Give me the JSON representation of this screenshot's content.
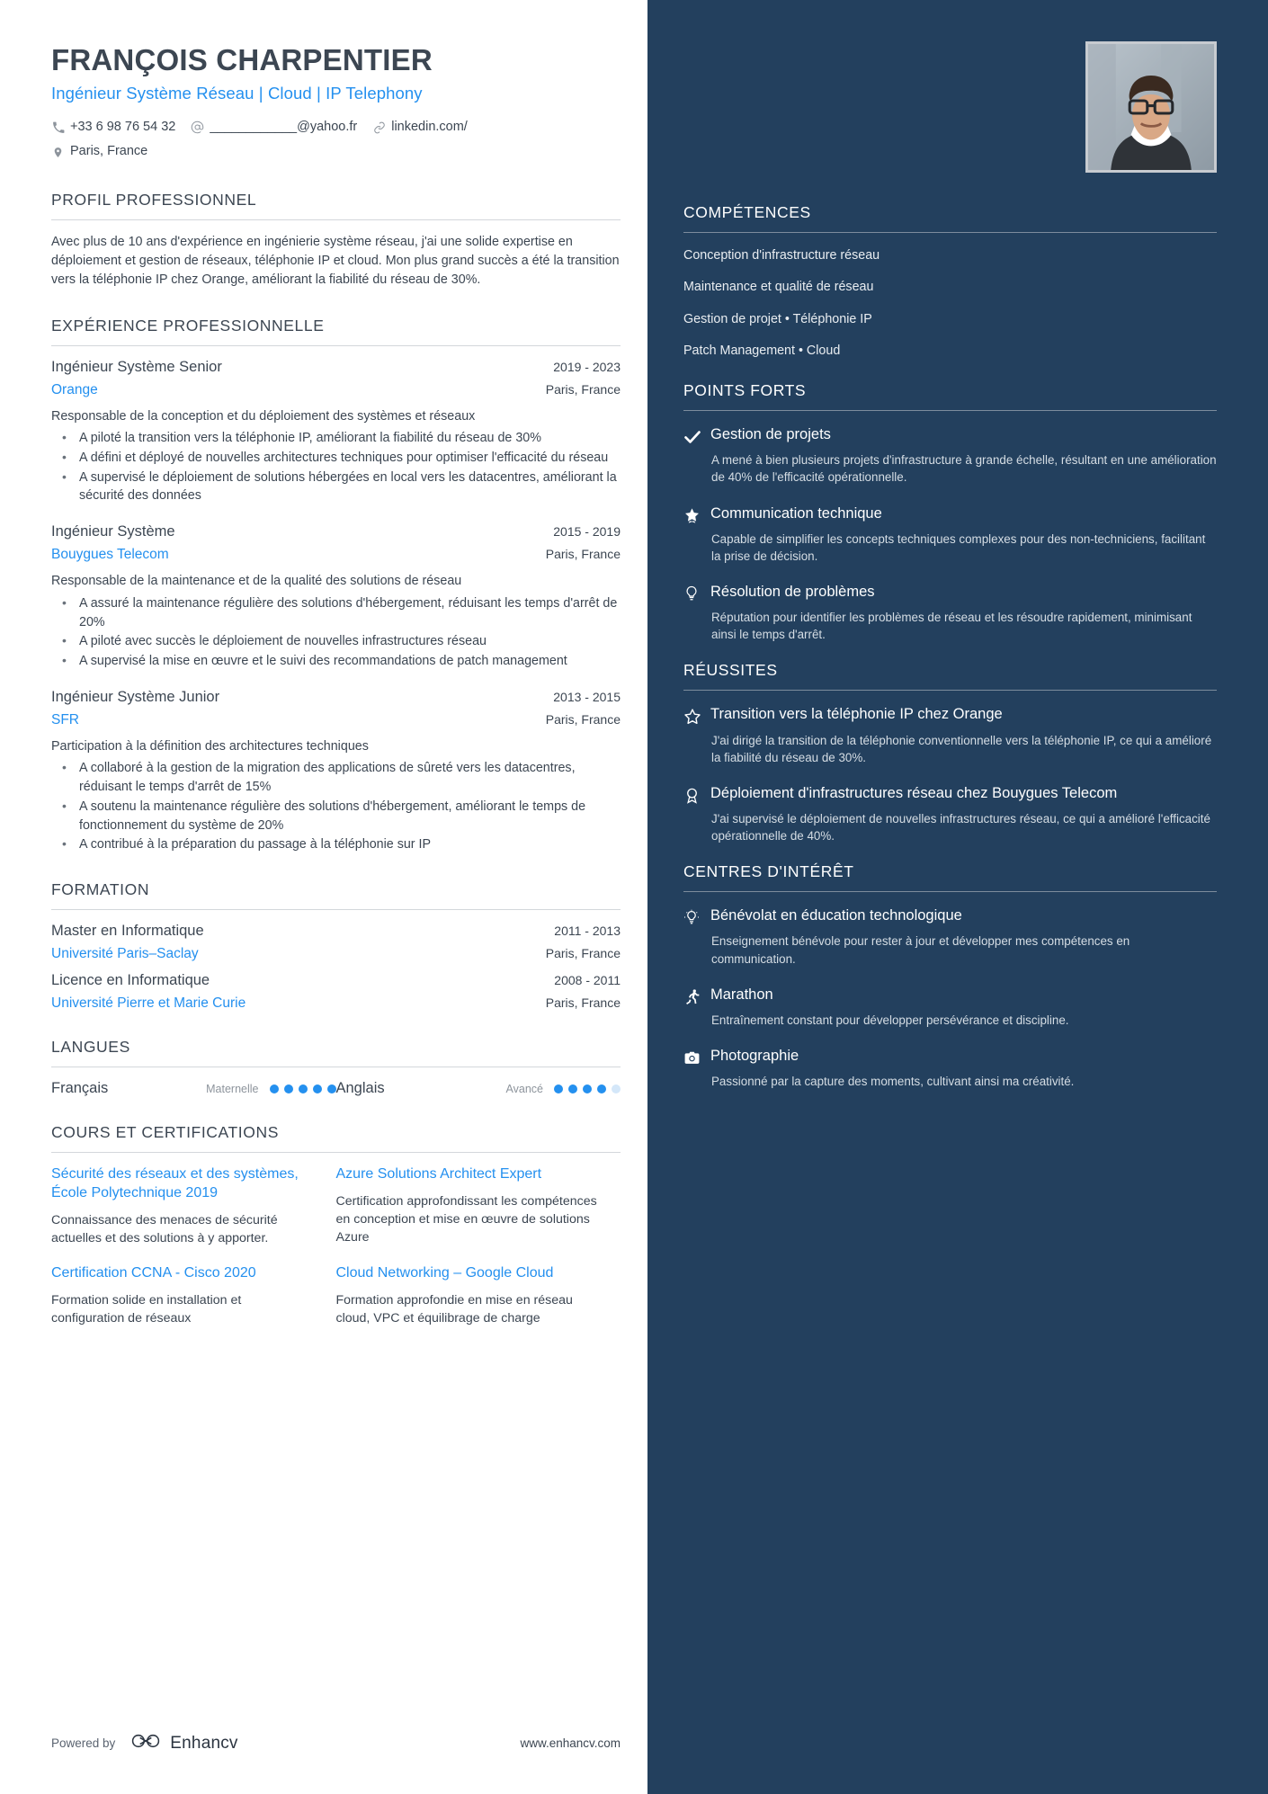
{
  "header": {
    "name": "FRANÇOIS CHARPENTIER",
    "headline": "Ingénieur Système Réseau | Cloud | IP Telephony",
    "phone": "+33 6 98 76 54 32",
    "email": "____________@yahoo.fr",
    "linkedin": "linkedin.com/",
    "location": "Paris, France"
  },
  "profile": {
    "title": "PROFIL PROFESSIONNEL",
    "text": "Avec plus de 10 ans d'expérience en ingénierie système réseau, j'ai une solide expertise en déploiement et gestion de réseaux, téléphonie IP et cloud. Mon plus grand succès a été la transition vers la téléphonie IP chez Orange, améliorant la fiabilité du réseau de 30%."
  },
  "experience": {
    "title": "EXPÉRIENCE PROFESSIONNELLE",
    "entries": [
      {
        "role": "Ingénieur Système Senior",
        "dates": "2019 - 2023",
        "company": "Orange",
        "location": "Paris, France",
        "summary": "Responsable de la conception et du déploiement des systèmes et réseaux",
        "bullets": [
          "A piloté la transition vers la téléphonie IP, améliorant la fiabilité du réseau de 30%",
          "A défini et déployé de nouvelles architectures techniques pour optimiser l'efficacité du réseau",
          "A supervisé le déploiement de solutions hébergées en local vers les datacentres, améliorant la sécurité des données"
        ]
      },
      {
        "role": "Ingénieur Système",
        "dates": "2015 - 2019",
        "company": "Bouygues Telecom",
        "location": "Paris, France",
        "summary": "Responsable de la maintenance et de la qualité des solutions de réseau",
        "bullets": [
          "A assuré la maintenance régulière des solutions d'hébergement, réduisant les temps d'arrêt de 20%",
          "A piloté avec succès le déploiement de nouvelles infrastructures réseau",
          "A supervisé la mise en œuvre et le suivi des recommandations de patch management"
        ]
      },
      {
        "role": "Ingénieur Système Junior",
        "dates": "2013 - 2015",
        "company": "SFR",
        "location": "Paris, France",
        "summary": "Participation à la définition des architectures techniques",
        "bullets": [
          "A collaboré à la gestion de la migration des applications de sûreté vers les datacentres, réduisant le temps d'arrêt de 15%",
          "A soutenu la maintenance régulière des solutions d'hébergement, améliorant le temps de fonctionnement du système de 20%",
          "A contribué à la préparation du passage à la téléphonie sur IP"
        ]
      }
    ]
  },
  "education": {
    "title": "FORMATION",
    "entries": [
      {
        "degree": "Master en Informatique",
        "dates": "2011 - 2013",
        "school": "Université Paris–Saclay",
        "location": "Paris, France"
      },
      {
        "degree": "Licence en Informatique",
        "dates": "2008 - 2011",
        "school": "Université Pierre et Marie Curie",
        "location": "Paris, France"
      }
    ]
  },
  "languages": {
    "title": "LANGUES",
    "items": [
      {
        "name": "Français",
        "level": "Maternelle",
        "filled": 5,
        "total": 5
      },
      {
        "name": "Anglais",
        "level": "Avancé",
        "filled": 4,
        "total": 5
      }
    ]
  },
  "courses": {
    "title": "COURS ET CERTIFICATIONS",
    "items": [
      {
        "title": "Sécurité des réseaux et des systèmes, École Polytechnique 2019",
        "desc": "Connaissance des menaces de sécurité actuelles et des solutions à y apporter."
      },
      {
        "title": "Azure Solutions Architect Expert",
        "desc": "Certification approfondissant les compétences en conception et mise en œuvre de solutions Azure"
      },
      {
        "title": "Certification CCNA - Cisco 2020",
        "desc": "Formation solide en installation et configuration de réseaux"
      },
      {
        "title": "Cloud Networking – Google Cloud",
        "desc": "Formation approfondie en mise en réseau cloud, VPC et équilibrage de charge"
      }
    ]
  },
  "footer": {
    "powered_by": "Powered by",
    "brand": "Enhancv",
    "url": "www.enhancv.com"
  },
  "skills": {
    "title": "COMPÉTENCES",
    "lines": [
      "Conception d'infrastructure réseau",
      "Maintenance et qualité de réseau",
      "Gestion de projet  •  Téléphonie IP",
      "Patch Management  •  Cloud"
    ]
  },
  "strengths": {
    "title": "POINTS FORTS",
    "items": [
      {
        "icon": "check-icon",
        "title": "Gestion de projets",
        "desc": "A mené à bien plusieurs projets d'infrastructure à grande échelle, résultant en une amélioration de 40% de l'efficacité opérationnelle."
      },
      {
        "icon": "star-badge-icon",
        "title": "Communication technique",
        "desc": "Capable de simplifier les concepts techniques complexes pour des non-techniciens, facilitant la prise de décision."
      },
      {
        "icon": "lightbulb-icon",
        "title": "Résolution de problèmes",
        "desc": "Réputation pour identifier les problèmes de réseau et les résoudre rapidement, minimisant ainsi le temps d'arrêt."
      }
    ]
  },
  "achievements": {
    "title": "RÉUSSITES",
    "items": [
      {
        "icon": "star-outline-icon",
        "title": "Transition vers la téléphonie IP chez Orange",
        "desc": "J'ai dirigé la transition de la téléphonie conventionnelle vers la téléphonie IP, ce qui a amélioré la fiabilité du réseau de 30%."
      },
      {
        "icon": "medal-icon",
        "title": "Déploiement d'infrastructures réseau chez Bouygues Telecom",
        "desc": "J'ai supervisé le déploiement de nouvelles infrastructures réseau, ce qui a amélioré l'efficacité opérationnelle de 40%."
      }
    ]
  },
  "interests": {
    "title": "CENTRES D'INTÉRÊT",
    "items": [
      {
        "icon": "lightbulb-idea-icon",
        "title": "Bénévolat en éducation technologique",
        "desc": "Enseignement bénévole pour rester à jour et développer mes compétences en communication."
      },
      {
        "icon": "runner-icon",
        "title": "Marathon",
        "desc": "Entraînement constant pour développer persévérance et discipline."
      },
      {
        "icon": "camera-icon",
        "title": "Photographie",
        "desc": "Passionné par la capture des moments, cultivant ainsi ma créativité."
      }
    ]
  },
  "colors": {
    "accent": "#2490ef",
    "sidebar_bg": "#23405e",
    "text": "#3c4652"
  }
}
